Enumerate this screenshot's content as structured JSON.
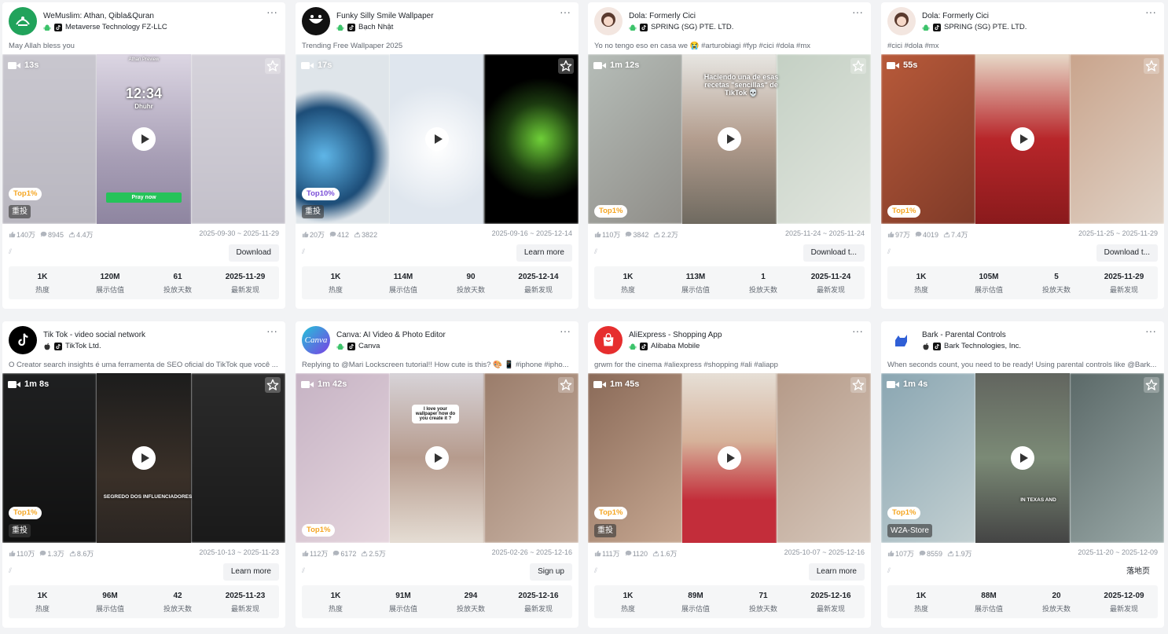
{
  "metric_labels": [
    "热度",
    "展示估值",
    "投放天数",
    "最新发现"
  ],
  "cards": [
    {
      "app": "WeMuslim: Athan, Qibla&Quran",
      "publisher": "Metaverse Technology FZ-LLC",
      "platforms": [
        "android-icon",
        "tiktok-icon"
      ],
      "desc": "May Allah bless you",
      "duration": "13s",
      "rank": "Top1%",
      "tag": "重投",
      "likes": "140万",
      "comments": "8945",
      "shares": "4.4万",
      "dates": "2025-09-30 ~ 2025-11-29",
      "button": "Download",
      "heat": "1K",
      "impressions": "120M",
      "days": "61",
      "latest": "2025-11-29",
      "overlay": [
        "12:34",
        "Dhuhr",
        "Pray now",
        "Athan Preview"
      ]
    },
    {
      "app": "Funky Silly Smile Wallpaper",
      "publisher": "Bạch Nhật",
      "platforms": [
        "android-icon",
        "tiktok-icon"
      ],
      "desc": "Trending Free Wallpaper 2025",
      "duration": "17s",
      "rank": "Top10%",
      "tag": "重投",
      "likes": "20万",
      "comments": "412",
      "shares": "3822",
      "dates": "2025-09-16 ~ 2025-12-14",
      "button": "Learn more",
      "heat": "1K",
      "impressions": "114M",
      "days": "90",
      "latest": "2025-12-14",
      "overlay": []
    },
    {
      "app": "Dola: Formerly Cici",
      "publisher": "SPRING (SG) PTE. LTD.",
      "platforms": [
        "android-icon",
        "tiktok-icon"
      ],
      "desc": "Yo no tengo eso en casa we 😭 #arturobiagi #fyp #cici #dola #mx",
      "duration": "1m 12s",
      "rank": "Top1%",
      "tag": "",
      "likes": "110万",
      "comments": "3842",
      "shares": "2.2万",
      "dates": "2025-11-24 ~ 2025-11-24",
      "button": "Download t...",
      "heat": "1K",
      "impressions": "113M",
      "days": "1",
      "latest": "2025-11-24",
      "overlay": [
        "Haciendo una de esas recetas \"sencillas\" de TikTok 💀"
      ]
    },
    {
      "app": "Dola: Formerly Cici",
      "publisher": "SPRING (SG) PTE. LTD.",
      "platforms": [
        "android-icon",
        "tiktok-icon"
      ],
      "desc": "#cici #dola #mx",
      "duration": "55s",
      "rank": "Top1%",
      "tag": "",
      "likes": "97万",
      "comments": "4019",
      "shares": "7.4万",
      "dates": "2025-11-25 ~ 2025-11-29",
      "button": "Download t...",
      "heat": "1K",
      "impressions": "105M",
      "days": "5",
      "latest": "2025-11-29",
      "overlay": []
    },
    {
      "app": "Tik Tok - video social network",
      "publisher": "TikTok Ltd.",
      "platforms": [
        "apple-icon",
        "tiktok-icon"
      ],
      "desc": "O Creator search insights é uma ferramenta de SEO oficial do TikTok que você ...",
      "duration": "1m 8s",
      "rank": "Top1%",
      "tag": "重投",
      "likes": "110万",
      "comments": "1.3万",
      "shares": "8.6万",
      "dates": "2025-10-13 ~ 2025-11-23",
      "button": "Learn more",
      "heat": "1K",
      "impressions": "96M",
      "days": "42",
      "latest": "2025-11-23",
      "overlay": [
        "SEGREDO DOS INFLUENCIADORES"
      ]
    },
    {
      "app": "Canva: AI Video & Photo Editor",
      "publisher": "Canva",
      "platforms": [
        "android-icon",
        "tiktok-icon"
      ],
      "desc": "Replying to @Mari Lockscreen tutorial!! How cute is this? 🎨 📱 #iphone #ipho...",
      "duration": "1m 42s",
      "rank": "Top1%",
      "tag": "",
      "likes": "112万",
      "comments": "6172",
      "shares": "2.5万",
      "dates": "2025-02-26 ~ 2025-12-16",
      "button": "Sign up",
      "heat": "1K",
      "impressions": "91M",
      "days": "294",
      "latest": "2025-12-16",
      "overlay": [
        "I love your wallpaper how do you create it ?"
      ]
    },
    {
      "app": "AliExpress - Shopping App",
      "publisher": "Alibaba Mobile",
      "platforms": [
        "android-icon",
        "tiktok-icon"
      ],
      "desc": "grwm for the cinema #aliexpress #shopping #ali #aliapp",
      "duration": "1m 45s",
      "rank": "Top1%",
      "tag": "重投",
      "likes": "111万",
      "comments": "1120",
      "shares": "1.6万",
      "dates": "2025-10-07 ~ 2025-12-16",
      "button": "Learn more",
      "heat": "1K",
      "impressions": "89M",
      "days": "71",
      "latest": "2025-12-16",
      "overlay": []
    },
    {
      "app": "Bark - Parental Controls",
      "publisher": "Bark Technologies, Inc.",
      "platforms": [
        "apple-icon",
        "tiktok-icon"
      ],
      "desc": "When seconds count, you need to be ready! Using parental controls like @Bark...",
      "duration": "1m 4s",
      "rank": "Top1%",
      "tag": "W2A-Store",
      "likes": "107万",
      "comments": "8559",
      "shares": "1.9万",
      "dates": "2025-11-20 ~ 2025-12-09",
      "button": "落地页",
      "heat": "1K",
      "impressions": "88M",
      "days": "20",
      "latest": "2025-12-09",
      "overlay": [
        "IN TEXAS AND"
      ]
    }
  ]
}
